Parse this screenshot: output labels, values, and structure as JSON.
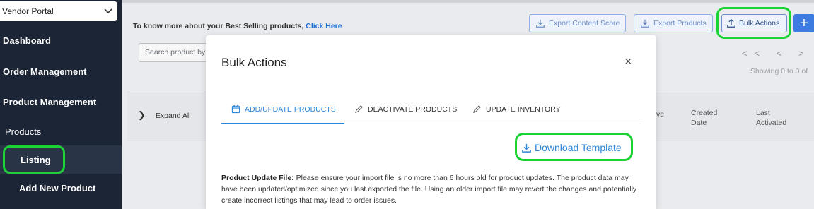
{
  "sidebar": {
    "vendor_select": "Vendor Portal",
    "items": [
      {
        "label": "Dashboard"
      },
      {
        "label": "Order Management"
      },
      {
        "label": "Product Management"
      },
      {
        "label": "Products"
      },
      {
        "label": "Listing"
      },
      {
        "label": "Add New Product"
      }
    ]
  },
  "header": {
    "promo_text": "To know more about your Best Selling products,",
    "promo_link": "Click Here",
    "buttons": {
      "export_content_score": "Export Content Score",
      "export_products": "Export Products",
      "bulk_actions": "Bulk Actions",
      "add": "+"
    }
  },
  "search": {
    "placeholder": "Search product by"
  },
  "pagination": {
    "icons": "<<  <  >  >",
    "showing": "Showing 0 to 0 of"
  },
  "table": {
    "expand_all": "Expand All",
    "columns": [
      {
        "label": "ve"
      },
      {
        "label": "Created Date"
      },
      {
        "label": "Last Activated"
      }
    ]
  },
  "modal": {
    "title": "Bulk Actions",
    "close": "×",
    "tabs": [
      {
        "label": "ADD/UPDATE PRODUCTS",
        "active": true
      },
      {
        "label": "DEACTIVATE PRODUCTS",
        "active": false
      },
      {
        "label": "UPDATE INVENTORY",
        "active": false
      }
    ],
    "download_template": "Download Template",
    "description_label": "Product Update File:",
    "description_text": "Please ensure your import file is no more than 6 hours old for product updates. The product data may have been updated/optimized since you last exported the file. Using an older import file may revert the changes and potentially create incorrect listings that may lead to order issues."
  },
  "colors": {
    "sidebar_bg": "#1c2536",
    "accent": "#2f86d6",
    "highlight": "#1bd334"
  }
}
